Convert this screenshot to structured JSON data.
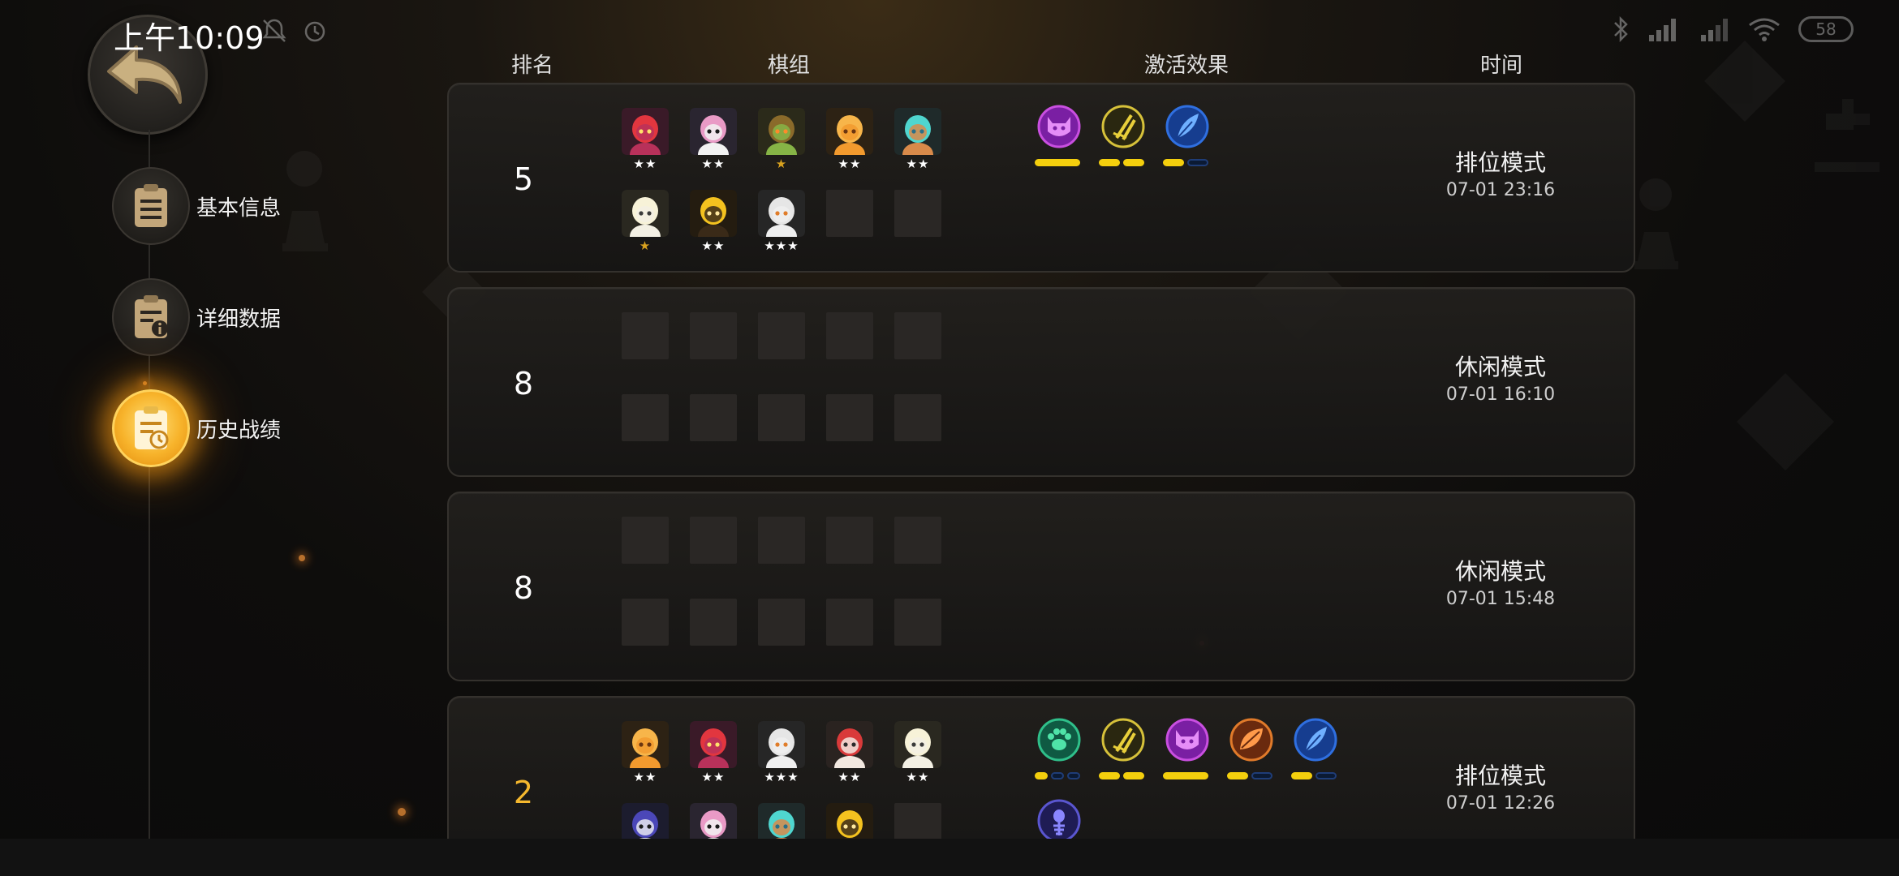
{
  "status_bar": {
    "time": "上午10:09",
    "battery": "58"
  },
  "sidebar": {
    "items": [
      {
        "label": "基本信息",
        "icon": "clipboard-icon",
        "active": false
      },
      {
        "label": "详细数据",
        "icon": "clipboard-info-icon",
        "active": false
      },
      {
        "label": "历史战绩",
        "icon": "clipboard-history-icon",
        "active": true
      }
    ]
  },
  "headers": {
    "rank": "排名",
    "lineup": "棋组",
    "traits": "激活效果",
    "time": "时间"
  },
  "colors": {
    "accent_gold": "#f5b82e",
    "trait_bar_on": "#f4cf0d",
    "trait_bar_off": "#1f3d77"
  },
  "matches": [
    {
      "rank": "5",
      "mode": "排位模式",
      "datetime": "07-01 23:16",
      "pieces": [
        {
          "icon": "red-demon-piece-icon",
          "stars": "★★"
        },
        {
          "icon": "pink-hair-skull-piece-icon",
          "stars": "★★"
        },
        {
          "icon": "green-ogre-piece-icon",
          "stars": "★"
        },
        {
          "icon": "orange-beast-piece-icon",
          "stars": "★★"
        },
        {
          "icon": "teal-robot-piece-icon",
          "stars": "★★"
        },
        {
          "icon": "white-hat-piece-icon",
          "stars": "★"
        },
        {
          "icon": "yellow-horn-piece-icon",
          "stars": "★★"
        },
        {
          "icon": "white-ghost-piece-icon",
          "stars": "★★★"
        },
        null,
        null
      ],
      "traits": [
        {
          "icon": "purple-demon-trait-icon",
          "on": 1,
          "total": 1
        },
        {
          "icon": "yellow-dagger-trait-icon",
          "on": 2,
          "total": 2
        },
        {
          "icon": "blue-feather-trait-icon",
          "on": 1,
          "total": 2
        }
      ]
    },
    {
      "rank": "8",
      "mode": "休闲模式",
      "datetime": "07-01 16:10",
      "pieces": [
        null,
        null,
        null,
        null,
        null,
        null,
        null,
        null,
        null,
        null
      ],
      "traits": []
    },
    {
      "rank": "8",
      "mode": "休闲模式",
      "datetime": "07-01 15:48",
      "pieces": [
        null,
        null,
        null,
        null,
        null,
        null,
        null,
        null,
        null,
        null
      ],
      "traits": []
    },
    {
      "rank": "2",
      "mode": "排位模式",
      "datetime": "07-01 12:26",
      "pieces": [
        {
          "icon": "orange-beast-piece-icon",
          "stars": "★★"
        },
        {
          "icon": "red-demon-piece-icon",
          "stars": "★★"
        },
        {
          "icon": "white-ghost-piece-icon",
          "stars": "★★★"
        },
        {
          "icon": "red-mask-piece-icon",
          "stars": "★★"
        },
        {
          "icon": "white-hat-piece-icon",
          "stars": "★★"
        },
        {
          "icon": "blue-hood-piece-icon",
          "stars": ""
        },
        {
          "icon": "pink-hair-skull-piece-icon",
          "stars": ""
        },
        {
          "icon": "teal-robot-piece-icon",
          "stars": ""
        },
        {
          "icon": "yellow-horn-piece-icon",
          "stars": ""
        },
        null
      ],
      "traits": [
        {
          "icon": "green-paw-trait-icon",
          "on": 1,
          "total": 3
        },
        {
          "icon": "yellow-dagger-trait-icon",
          "on": 2,
          "total": 2
        },
        {
          "icon": "purple-demon-trait-icon",
          "on": 1,
          "total": 1
        },
        {
          "icon": "orange-leaf-trait-icon",
          "on": 1,
          "total": 2
        },
        {
          "icon": "blue-feather-trait-icon",
          "on": 1,
          "total": 2
        },
        {
          "icon": "indigo-fish-trait-icon",
          "on": 0,
          "total": 0
        }
      ]
    }
  ]
}
